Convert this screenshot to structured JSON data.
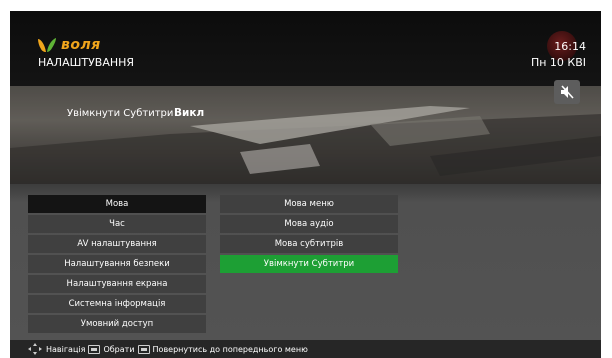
{
  "brand": {
    "name": "воля",
    "accent": "#f0a51c"
  },
  "header": {
    "title": "НАЛАШТУВАННЯ",
    "time": "16:14",
    "date": "Пн 10 КВІ"
  },
  "preview": {
    "setting_label": "Увімкнути Субтитри",
    "setting_value": "Викл"
  },
  "left_menu": {
    "items": [
      "Мова",
      "Час",
      "AV налаштування",
      "Налаштування безпеки",
      "Налаштування екрана",
      "Системна інформація",
      "Умовний доступ"
    ],
    "selected": "Мова"
  },
  "right_menu": {
    "items": [
      "Мова меню",
      "Мова аудіо",
      "Мова субтитрів",
      "Увімкнути Субтитри"
    ],
    "highlighted": "Увімкнути Субтитри",
    "highlight_color": "#1d9f34"
  },
  "footer": {
    "navigate": "Навігація",
    "select": "Обрати",
    "back": "Повернутись до попереднього меню"
  },
  "icons": [
    "voila-logo-icon",
    "channel-badge-icon",
    "mute-icon",
    "dpad-icon",
    "ok-key-icon",
    "back-key-icon"
  ]
}
